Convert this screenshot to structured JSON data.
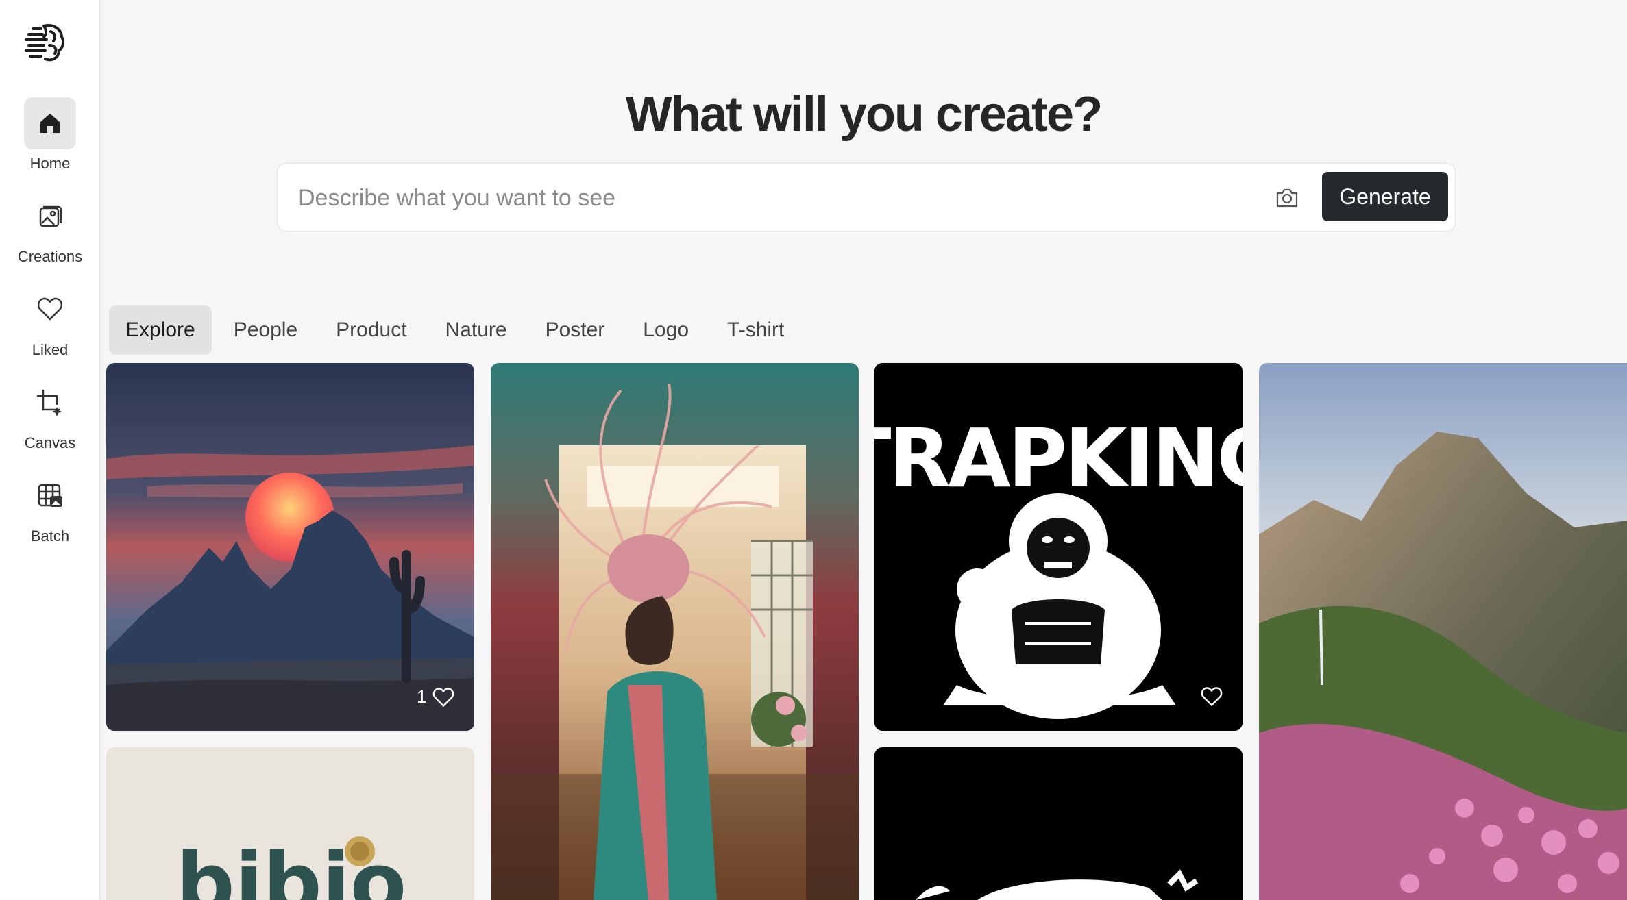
{
  "app": {
    "logo_icon": "brain-logo-icon"
  },
  "sidebar": {
    "items": [
      {
        "label": "Home",
        "icon": "home-icon",
        "active": true
      },
      {
        "label": "Creations",
        "icon": "image-icon",
        "active": false
      },
      {
        "label": "Liked",
        "icon": "heart-icon",
        "active": false
      },
      {
        "label": "Canvas",
        "icon": "crop-sparkle-icon",
        "active": false
      },
      {
        "label": "Batch",
        "icon": "grid-image-icon",
        "active": false
      }
    ]
  },
  "hero": {
    "title": "What will you create?"
  },
  "prompt": {
    "placeholder": "Describe what you want to see",
    "value": "",
    "camera_icon": "camera-icon",
    "generate_label": "Generate"
  },
  "tabs": [
    {
      "label": "Explore",
      "active": true
    },
    {
      "label": "People",
      "active": false
    },
    {
      "label": "Product",
      "active": false
    },
    {
      "label": "Nature",
      "active": false
    },
    {
      "label": "Poster",
      "active": false
    },
    {
      "label": "Logo",
      "active": false
    },
    {
      "label": "T-shirt",
      "active": false
    }
  ],
  "gallery": [
    {
      "subject": "desert sunset with cactus",
      "likes": "1"
    },
    {
      "subject": "woman with feather headdress",
      "likes": ""
    },
    {
      "subject": "Trapking gorilla logo",
      "text": "TRAPKING",
      "likes": ""
    },
    {
      "subject": "mountain with pink flowers",
      "likes": ""
    },
    {
      "subject": "bibio logo",
      "text": "bibio",
      "likes": ""
    },
    {
      "subject": "black logo card",
      "likes": ""
    }
  ],
  "colors": {
    "accent": "#262a2e",
    "background": "#f6f6f6",
    "sidebar": "#ffffff",
    "active_tab": "#e2e2e2"
  }
}
